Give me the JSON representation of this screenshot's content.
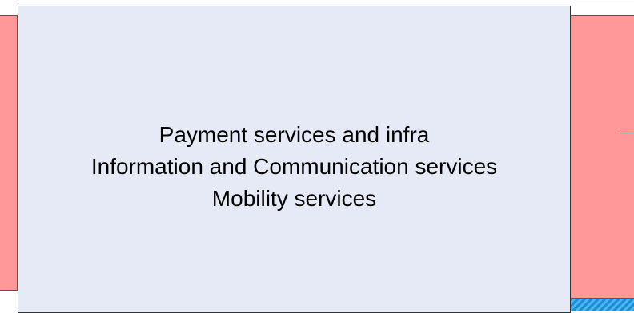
{
  "diagram": {
    "main_box": {
      "lines": [
        "Payment services and infra",
        "Information and Communication services",
        "Mobility services"
      ]
    },
    "colors": {
      "main_fill": "#e6eaf6",
      "side_fill": "#ff9999",
      "strip": "#1a8fd8"
    }
  }
}
